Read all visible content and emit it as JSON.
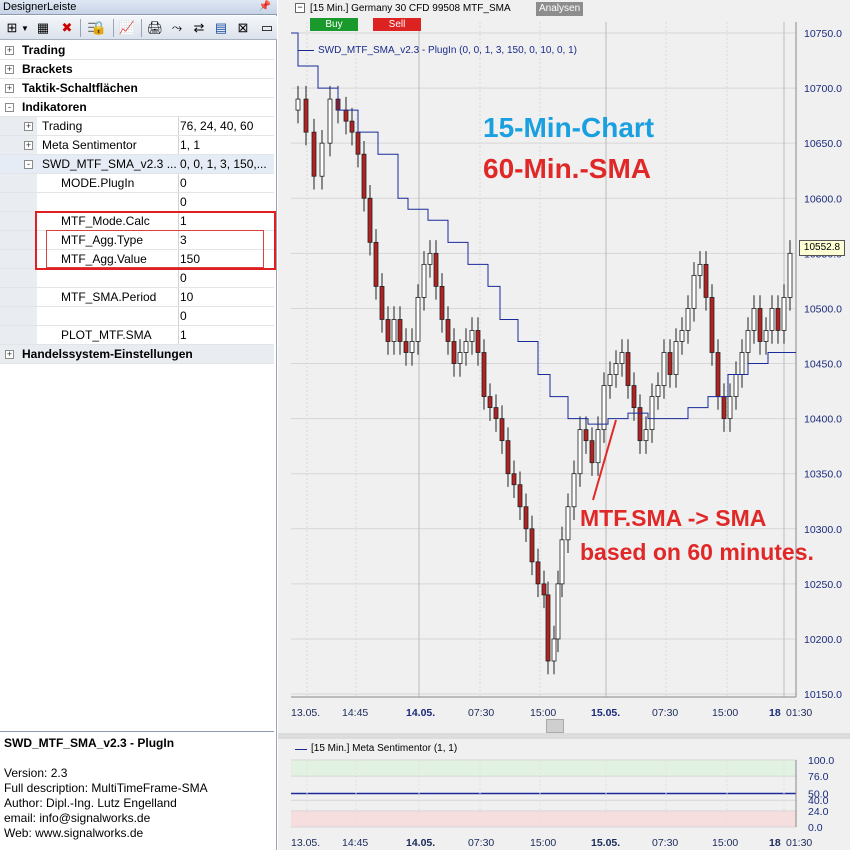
{
  "left_panel": {
    "title": "DesignerLeiste",
    "pin_icon": "pin-icon",
    "toolbar_icons": [
      "new-icon",
      "dropdown-icon",
      "grid-icon",
      "delete-icon",
      "list-icon",
      "lock-icon",
      "chart-icon",
      "print-icon",
      "link-icon",
      "swap-icon",
      "bars-icon",
      "compress-icon",
      "window-icon"
    ],
    "sections": [
      {
        "label": "Trading",
        "state": "+"
      },
      {
        "label": "Brackets",
        "state": "+"
      },
      {
        "label": "Taktik-Schaltflächen",
        "state": "+"
      },
      {
        "label": "Indikatoren",
        "state": "-"
      }
    ],
    "indicators": [
      {
        "label": "Trading",
        "value": "76, 24, 40, 60",
        "state": "+"
      },
      {
        "label": "Meta Sentimentor",
        "value": "1, 1",
        "state": "+"
      },
      {
        "label": "SWD_MTF_SMA_v2.3 ...",
        "value": "0, 0, 1, 3, 150,...",
        "state": "-"
      }
    ],
    "properties": [
      {
        "label": "MODE.PlugIn",
        "value": "0"
      },
      {
        "label": "",
        "value": "0"
      },
      {
        "label": "MTF_Mode.Calc",
        "value": "1"
      },
      {
        "label": "MTF_Agg.Type",
        "value": "3"
      },
      {
        "label": "MTF_Agg.Value",
        "value": "150"
      },
      {
        "label": "",
        "value": "0"
      },
      {
        "label": "MTF_SMA.Period",
        "value": "10"
      },
      {
        "label": "",
        "value": "0"
      },
      {
        "label": "PLOT_MTF.SMA",
        "value": "1"
      }
    ],
    "last_section": {
      "label": "Handelssystem-Einstellungen",
      "state": "+"
    },
    "description": {
      "title": "SWD_MTF_SMA_v2.3 - PlugIn",
      "lines": [
        "Version: 2.3",
        "Full description: MultiTimeFrame-SMA",
        "Author: Dipl.-Ing. Lutz Engelland",
        "email: info@signalworks.de",
        "Web: www.signalworks.de"
      ]
    }
  },
  "chart": {
    "header": "[15 Min.] Germany 30 CFD   99508 MTF_SMA",
    "analysen": "Analysen",
    "buy_label": "Buy",
    "sell_label": "Sell",
    "indicator_label": "SWD_MTF_SMA_v2.3 - PlugIn  (0, 0, 1, 3, 150, 0, 10, 0, 1)",
    "annotation_1": "15-Min-Chart",
    "annotation_2": "60-Min.-SMA",
    "annotation_3": "MTF.SMA -> SMA",
    "annotation_4": "based on 60 minutes.",
    "last_price": "10552.8",
    "y_ticks": [
      "10750.0",
      "10700.0",
      "10650.0",
      "10600.0",
      "10550.0",
      "10500.0",
      "10450.0",
      "10400.0",
      "10350.0",
      "10300.0",
      "10250.0",
      "10200.0",
      "10150.0"
    ],
    "x_ticks": [
      {
        "label": "13.05.",
        "bold": false
      },
      {
        "label": "14:45",
        "bold": false
      },
      {
        "label": "14.05.",
        "bold": true
      },
      {
        "label": "07:30",
        "bold": false
      },
      {
        "label": "15:00",
        "bold": false
      },
      {
        "label": "15.05.",
        "bold": true
      },
      {
        "label": "07:30",
        "bold": false
      },
      {
        "label": "15:00",
        "bold": false
      },
      {
        "label": "18",
        "bold": true
      },
      {
        "label": "01:30",
        "bold": false
      }
    ],
    "sub_header": "[15 Min.] Meta Sentimentor  (1, 1)",
    "sub_y_ticks": [
      "100.0",
      "76.0",
      "50.0",
      "40.0",
      "24.0",
      "0.0"
    ],
    "colors": {
      "bull": "#ffffff",
      "bear": "#b22222",
      "sma": "#1a2a9a",
      "grid": "#cfcfcf"
    }
  }
}
